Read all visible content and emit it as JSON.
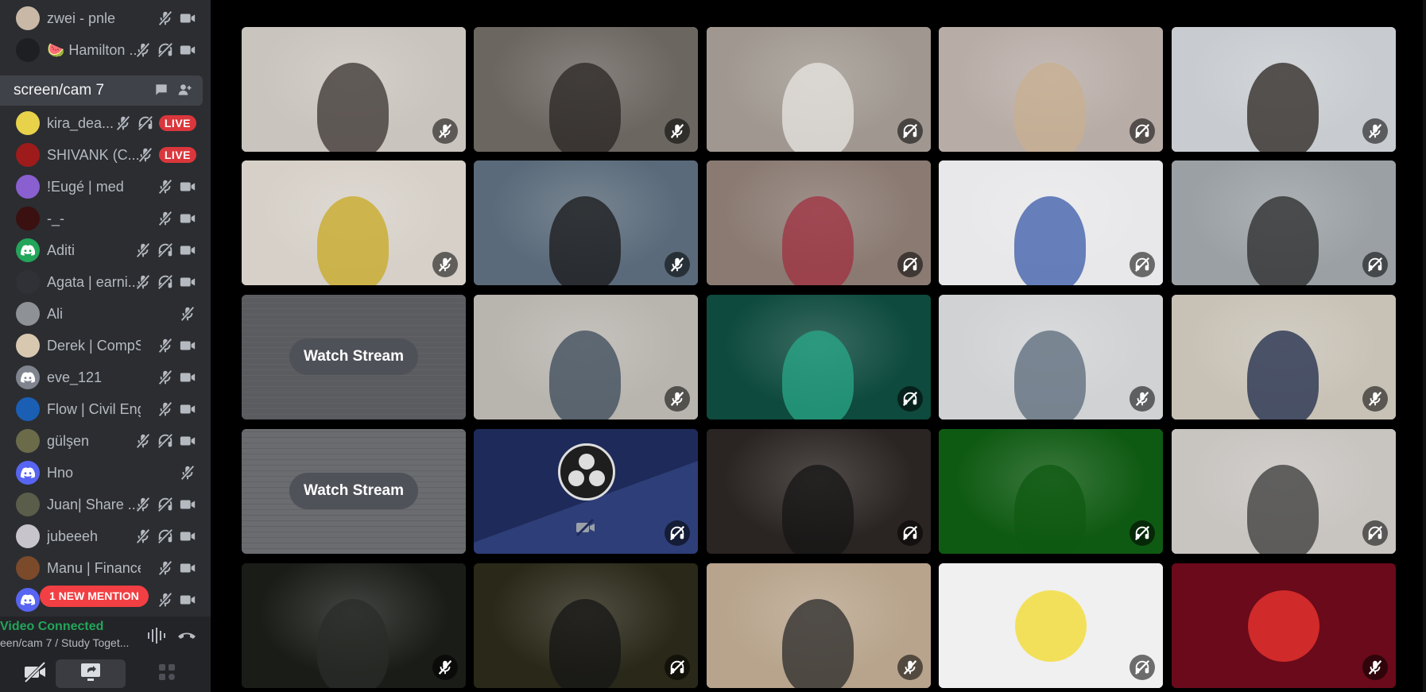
{
  "sidebar": {
    "top_members": [
      {
        "name": "zwei - pnle",
        "avatar_color": "#c9b8a6",
        "icons": [
          "mic-muted-icon",
          "camera-icon"
        ]
      },
      {
        "name": "🍉 Hamilton ...",
        "avatar_color": "#1e1f22",
        "icons": [
          "mic-muted-icon",
          "deafened-icon",
          "camera-icon"
        ]
      }
    ],
    "channel": {
      "name": "screen/cam 7"
    },
    "members": [
      {
        "name": "kira_dea...",
        "avatar_color": "#e8d24a",
        "icons": [
          "mic-muted-icon",
          "deafened-icon"
        ],
        "badge": "LIVE"
      },
      {
        "name": "SHIVANK (C...",
        "avatar_color": "#9e1b1b",
        "icons": [
          "mic-muted-icon"
        ],
        "badge": "LIVE"
      },
      {
        "name": "!Eugé | med",
        "avatar_color": "#8a5fd0",
        "icons": [
          "mic-muted-icon",
          "camera-icon"
        ]
      },
      {
        "name": "-_-",
        "avatar_color": "#3b1010",
        "icons": [
          "mic-muted-icon",
          "camera-icon"
        ]
      },
      {
        "name": "Aditi",
        "avatar_color": "#23a55a",
        "icons": [
          "mic-muted-icon",
          "deafened-icon",
          "camera-icon"
        ],
        "discord": true
      },
      {
        "name": "Agata | earni...",
        "avatar_color": "#2f3136",
        "icons": [
          "mic-muted-icon",
          "deafened-icon",
          "camera-icon"
        ]
      },
      {
        "name": "Ali",
        "avatar_color": "#8e9196",
        "icons": [
          "mic-muted-icon"
        ]
      },
      {
        "name": "Derek | CompSci",
        "avatar_color": "#d8c8b0",
        "icons": [
          "mic-muted-icon",
          "camera-icon"
        ]
      },
      {
        "name": "eve_121",
        "avatar_color": "#80848e",
        "icons": [
          "mic-muted-icon",
          "camera-icon"
        ],
        "discord": true
      },
      {
        "name": "Flow | Civil Eng",
        "avatar_color": "#1a5fb4",
        "icons": [
          "mic-muted-icon",
          "camera-icon"
        ]
      },
      {
        "name": "gülşen",
        "avatar_color": "#6b6b4a",
        "icons": [
          "mic-muted-icon",
          "deafened-icon",
          "camera-icon"
        ]
      },
      {
        "name": "Hno",
        "avatar_color": "#5865f2",
        "icons": [
          "mic-muted-icon"
        ],
        "discord": true
      },
      {
        "name": "Juan| Share ...",
        "avatar_color": "#5a5d4a",
        "icons": [
          "mic-muted-icon",
          "deafened-icon",
          "camera-icon"
        ]
      },
      {
        "name": "jubeeeh",
        "avatar_color": "#c8c4cc",
        "icons": [
          "mic-muted-icon",
          "deafened-icon",
          "camera-icon"
        ]
      },
      {
        "name": "Manu | Finance",
        "avatar_color": "#7a4a2a",
        "icons": [
          "mic-muted-icon",
          "camera-icon"
        ]
      },
      {
        "name": "",
        "avatar_color": "#5865f2",
        "icons": [
          "mic-muted-icon",
          "camera-icon"
        ],
        "discord": true
      }
    ],
    "mention_pill": "1 NEW MENTION",
    "voice": {
      "status": "Video Connected",
      "channel": "een/cam 7 / Study Toget..."
    }
  },
  "grid": {
    "watch_stream_label": "Watch Stream",
    "tiles": [
      {
        "kind": "camera",
        "bg": "#c9c4bd",
        "fg": "#3a3330",
        "mute": "mic"
      },
      {
        "kind": "camera",
        "bg": "#6b6660",
        "fg": "#2a2624",
        "mute": "mic"
      },
      {
        "kind": "camera",
        "bg": "#a09890",
        "fg": "#e8e6e2",
        "mute": "deaf"
      },
      {
        "kind": "camera",
        "bg": "#b8aca6",
        "fg": "#c8b090",
        "mute": "deaf"
      },
      {
        "kind": "camera",
        "bg": "#c8ccd0",
        "fg": "#2a2420",
        "mute": "mic"
      },
      {
        "kind": "camera",
        "bg": "#d6d0c8",
        "fg": "#c8a820",
        "mute": "mic"
      },
      {
        "kind": "camera",
        "bg": "#5a6a7a",
        "fg": "#1a1a1a",
        "mute": "mic"
      },
      {
        "kind": "camera",
        "bg": "#8a7a72",
        "fg": "#a03040",
        "mute": "deaf"
      },
      {
        "kind": "camera",
        "bg": "#e8e8ea",
        "fg": "#3a5aa8",
        "mute": "deaf"
      },
      {
        "kind": "camera",
        "bg": "#9aa0a4",
        "fg": "#2a2a2a",
        "mute": "deaf"
      },
      {
        "kind": "stream",
        "bg": "#5a5c60"
      },
      {
        "kind": "camera",
        "bg": "#b8b4ae",
        "fg": "#3a4a5a",
        "mute": "mic"
      },
      {
        "kind": "camera",
        "bg": "#0e4a3e",
        "fg": "#2aa888",
        "mute": "deaf"
      },
      {
        "kind": "camera",
        "bg": "#d0d2d4",
        "fg": "#5a6a7a",
        "mute": "mic"
      },
      {
        "kind": "camera",
        "bg": "#c8c2b6",
        "fg": "#1e2a4a",
        "mute": "mic"
      },
      {
        "kind": "stream",
        "bg": "#6a6c70"
      },
      {
        "kind": "obs",
        "bg": "#1e2a5a",
        "mute": "deaf"
      },
      {
        "kind": "camera",
        "bg": "#2a2422",
        "fg": "#151515",
        "mute": "deaf"
      },
      {
        "kind": "camera",
        "bg": "#0f5a12",
        "fg": "#0f5a12",
        "mute": "deaf"
      },
      {
        "kind": "camera",
        "bg": "#c8c4c0",
        "fg": "#3a3a3a",
        "mute": "deaf"
      },
      {
        "kind": "camera",
        "bg": "#1a1c18",
        "fg": "#2a2c28",
        "mute": "mic"
      },
      {
        "kind": "camera",
        "bg": "#2a2818",
        "fg": "#151515",
        "mute": "deaf"
      },
      {
        "kind": "camera",
        "bg": "#b8a48c",
        "fg": "#2a2a2a",
        "mute": "mic"
      },
      {
        "kind": "avatar",
        "bg": "#f0f0f0",
        "fg": "#f2e05a",
        "mute": "deaf"
      },
      {
        "kind": "avatar",
        "bg": "#6a0a1a",
        "fg": "#d02a2a",
        "mute": "mic"
      }
    ]
  }
}
